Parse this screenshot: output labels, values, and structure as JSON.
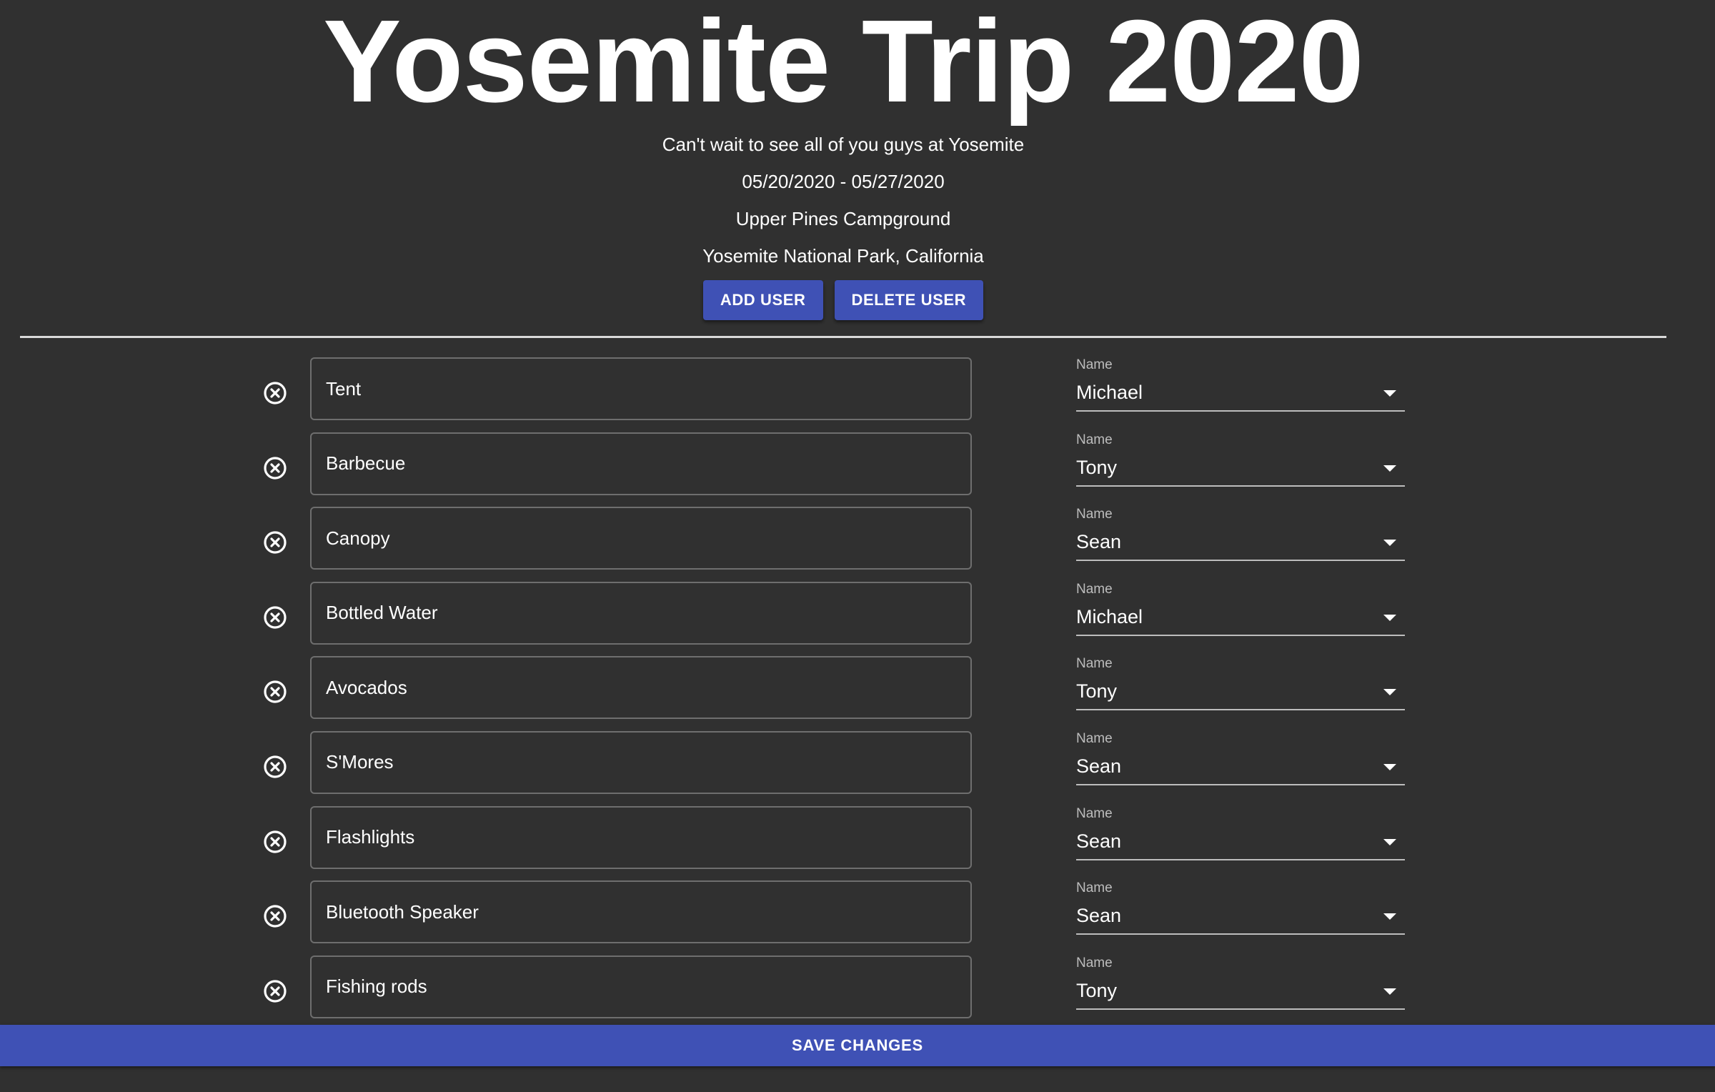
{
  "trip": {
    "title": "Yosemite Trip 2020",
    "message": "Can't wait to see all of you guys at Yosemite",
    "dates": "05/20/2020 - 05/27/2020",
    "campground": "Upper Pines Campground",
    "location": "Yosemite National Park, California"
  },
  "actions": {
    "add_user_label": "ADD USER",
    "delete_user_label": "DELETE USER",
    "save_label": "SAVE CHANGES"
  },
  "assignee_label": "Name",
  "items": [
    {
      "item": "Tent",
      "assignee": "Michael"
    },
    {
      "item": "Barbecue",
      "assignee": "Tony"
    },
    {
      "item": "Canopy",
      "assignee": "Sean"
    },
    {
      "item": "Bottled Water",
      "assignee": "Michael"
    },
    {
      "item": "Avocados",
      "assignee": "Tony"
    },
    {
      "item": "S'Mores",
      "assignee": "Sean"
    },
    {
      "item": "Flashlights",
      "assignee": "Sean"
    },
    {
      "item": "Bluetooth Speaker",
      "assignee": "Sean"
    },
    {
      "item": "Fishing rods",
      "assignee": "Tony"
    }
  ],
  "icons": {
    "remove": "close-circle-icon",
    "dropdown": "chevron-down-icon"
  },
  "colors": {
    "background": "#303030",
    "accent": "#3f51b5",
    "text": "#ffffff"
  }
}
